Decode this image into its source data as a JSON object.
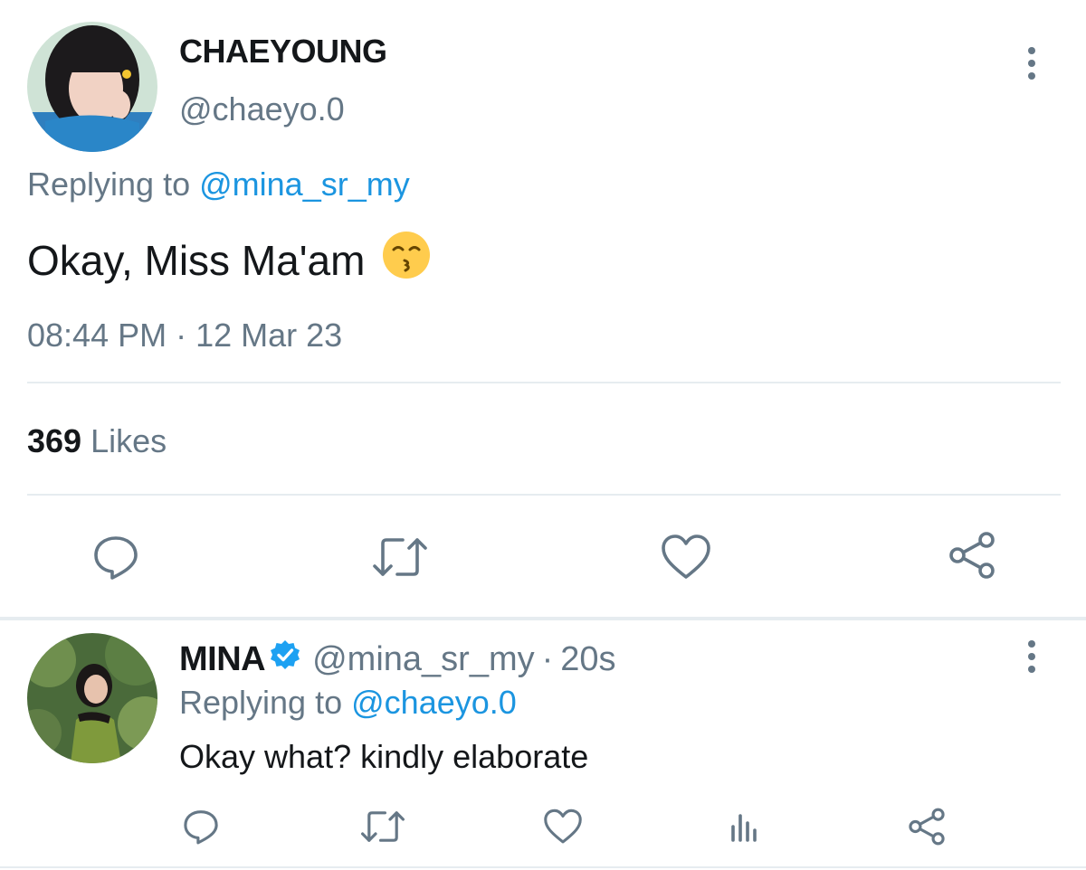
{
  "main_tweet": {
    "display_name": "CHAEYOUNG",
    "handle": "@chaeyo.0",
    "replying_prefix": "Replying to",
    "replying_handle": "@mina_sr_my",
    "text": "Okay, Miss Ma'am",
    "emoji_icon": "kissing-face-emoji",
    "timestamp": "08:44 PM · 12 Mar 23",
    "likes_count": "369",
    "likes_label": "Likes",
    "actions": [
      "reply-icon",
      "retweet-icon",
      "like-icon",
      "share-icon"
    ]
  },
  "reply_tweet": {
    "display_name": "MINA",
    "verified": true,
    "handle": "@mina_sr_my",
    "separator": "·",
    "time_ago": "20s",
    "replying_prefix": "Replying to",
    "replying_handle": "@chaeyo.0",
    "text": "Okay what? kindly elaborate",
    "actions": [
      "reply-icon",
      "retweet-icon",
      "like-icon",
      "analytics-icon",
      "share-icon"
    ]
  },
  "colors": {
    "text_primary": "#14171a",
    "text_secondary": "#657786",
    "link": "#1b95e0",
    "verified": "#1da1f2",
    "divider": "#e6ecf0"
  }
}
